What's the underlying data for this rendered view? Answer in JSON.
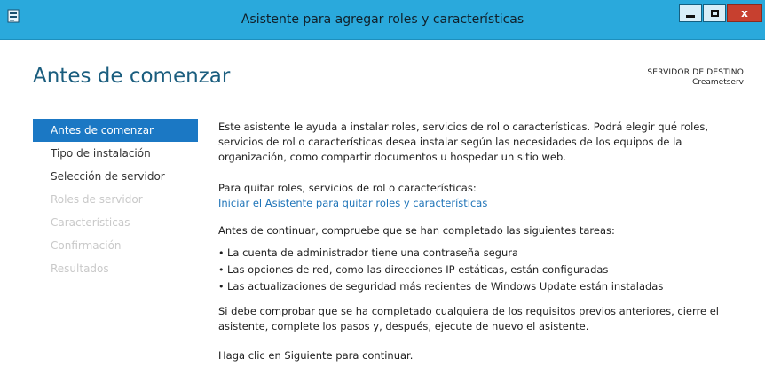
{
  "window": {
    "title": "Asistente para agregar roles y características",
    "controls": {
      "minimize": "minimize",
      "maximize": "maximize",
      "close": "x"
    }
  },
  "header": {
    "page_title": "Antes de comenzar",
    "destination_label": "SERVIDOR DE DESTINO",
    "destination_server": "Creametserv"
  },
  "nav": {
    "items": [
      {
        "label": "Antes de comenzar",
        "state": "active"
      },
      {
        "label": "Tipo de instalación",
        "state": "enabled"
      },
      {
        "label": "Selección de servidor",
        "state": "enabled"
      },
      {
        "label": "Roles de servidor",
        "state": "disabled"
      },
      {
        "label": "Características",
        "state": "disabled"
      },
      {
        "label": "Confirmación",
        "state": "disabled"
      },
      {
        "label": "Resultados",
        "state": "disabled"
      }
    ]
  },
  "content": {
    "intro": "Este asistente le ayuda a instalar roles, servicios de rol o características. Podrá elegir qué roles, servicios de rol o características desea instalar según las necesidades de los equipos de la organización, como compartir documentos u hospedar un sitio web.",
    "remove_label": "Para quitar roles, servicios de rol o características:",
    "remove_link": "Iniciar el Asistente para quitar roles y características",
    "tasks_intro": "Antes de continuar, compruebe que se han completado las siguientes tareas:",
    "tasks": [
      "La cuenta de administrador tiene una contraseña segura",
      "Las opciones de red, como las direcciones IP estáticas, están configuradas",
      "Las actualizaciones de seguridad más recientes de Windows Update están instaladas"
    ],
    "recheck": "Si debe comprobar que se ha completado cualquiera de los requisitos previos anteriores, cierre el asistente, complete los pasos y, después, ejecute de nuevo el asistente.",
    "next_hint": "Haga clic en Siguiente para continuar."
  },
  "colors": {
    "titlebar": "#2aa9dc",
    "accent": "#1b78c4",
    "heading": "#1a5d7e",
    "link": "#1f74b8",
    "close_button": "#c7402f"
  }
}
